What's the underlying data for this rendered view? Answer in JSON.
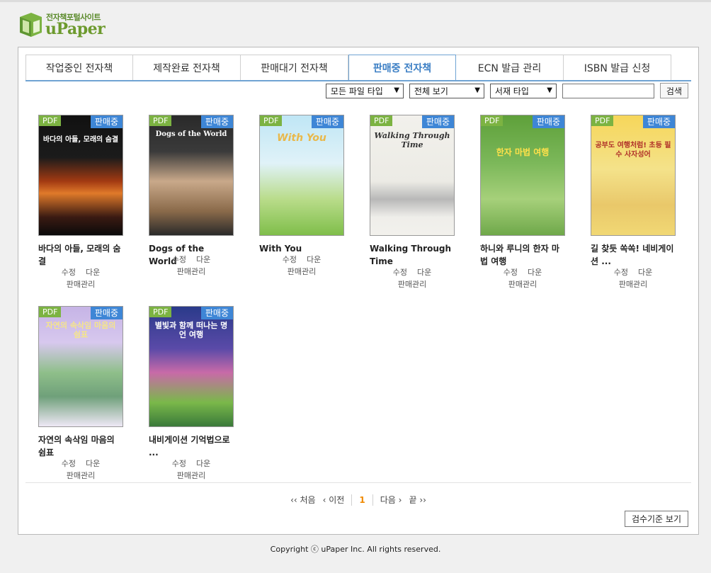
{
  "logo": {
    "subtitle": "전자책포털사이트",
    "name": "uPaper"
  },
  "tabs": [
    {
      "label": "작업중인 전자책",
      "active": false
    },
    {
      "label": "제작완료 전자책",
      "active": false
    },
    {
      "label": "판매대기 전자책",
      "active": false
    },
    {
      "label": "판매중 전자책",
      "active": true
    },
    {
      "label": "ECN 발급 관리",
      "active": false
    },
    {
      "label": "ISBN 발급 신청",
      "active": false
    }
  ],
  "filters": {
    "file_type": "모든 파일 타입",
    "view": "전체 보기",
    "shelf_type": "서재 타입",
    "search_value": "",
    "search_button": "검색"
  },
  "books": [
    {
      "title": "바다의 아들, 모래의 숨결",
      "cover_text": "바다의 아들, 모래의 숨결",
      "type": "PDF",
      "status": "판매중",
      "edit": "수정",
      "download": "다운",
      "manage": "판매관리"
    },
    {
      "title": "Dogs of the World",
      "cover_text": "Dogs of the World",
      "type": "PDF",
      "status": "판매중",
      "edit": "수정",
      "download": "다운",
      "manage": "판매관리"
    },
    {
      "title": "With You",
      "cover_text": "With You",
      "type": "PDF",
      "status": "판매중",
      "edit": "수정",
      "download": "다운",
      "manage": "판매관리"
    },
    {
      "title": "Walking Through Time",
      "cover_text": "Walking Through Time",
      "type": "PDF",
      "status": "판매중",
      "edit": "수정",
      "download": "다운",
      "manage": "판매관리"
    },
    {
      "title": "하니와 루니의 한자 마법 여행",
      "cover_text": "한자 마법 여행",
      "type": "PDF",
      "status": "판매중",
      "edit": "수정",
      "download": "다운",
      "manage": "판매관리"
    },
    {
      "title": "길 찾듯 쏙쏙! 네비게이션 ...",
      "cover_text": "공부도 여행처럼! 초등 필수 사자성어",
      "type": "PDF",
      "status": "판매중",
      "edit": "수정",
      "download": "다운",
      "manage": "판매관리"
    },
    {
      "title": "자연의 속삭임 마음의 쉼표",
      "cover_text": "자연의 속삭임 마음의 쉼표",
      "type": "PDF",
      "status": "판매중",
      "edit": "수정",
      "download": "다운",
      "manage": "판매관리"
    },
    {
      "title": "내비게이션 기억법으로 ...",
      "cover_text": "별빛과 함께 떠나는 명언 여행",
      "type": "PDF",
      "status": "판매중",
      "edit": "수정",
      "download": "다운",
      "manage": "판매관리"
    }
  ],
  "pager": {
    "first": "처음",
    "prev": "이전",
    "current": "1",
    "next": "다음",
    "last": "끝"
  },
  "review_button": "검수기준 보기",
  "footer": "Copyright ⓒ uPaper Inc. All rights reserved."
}
